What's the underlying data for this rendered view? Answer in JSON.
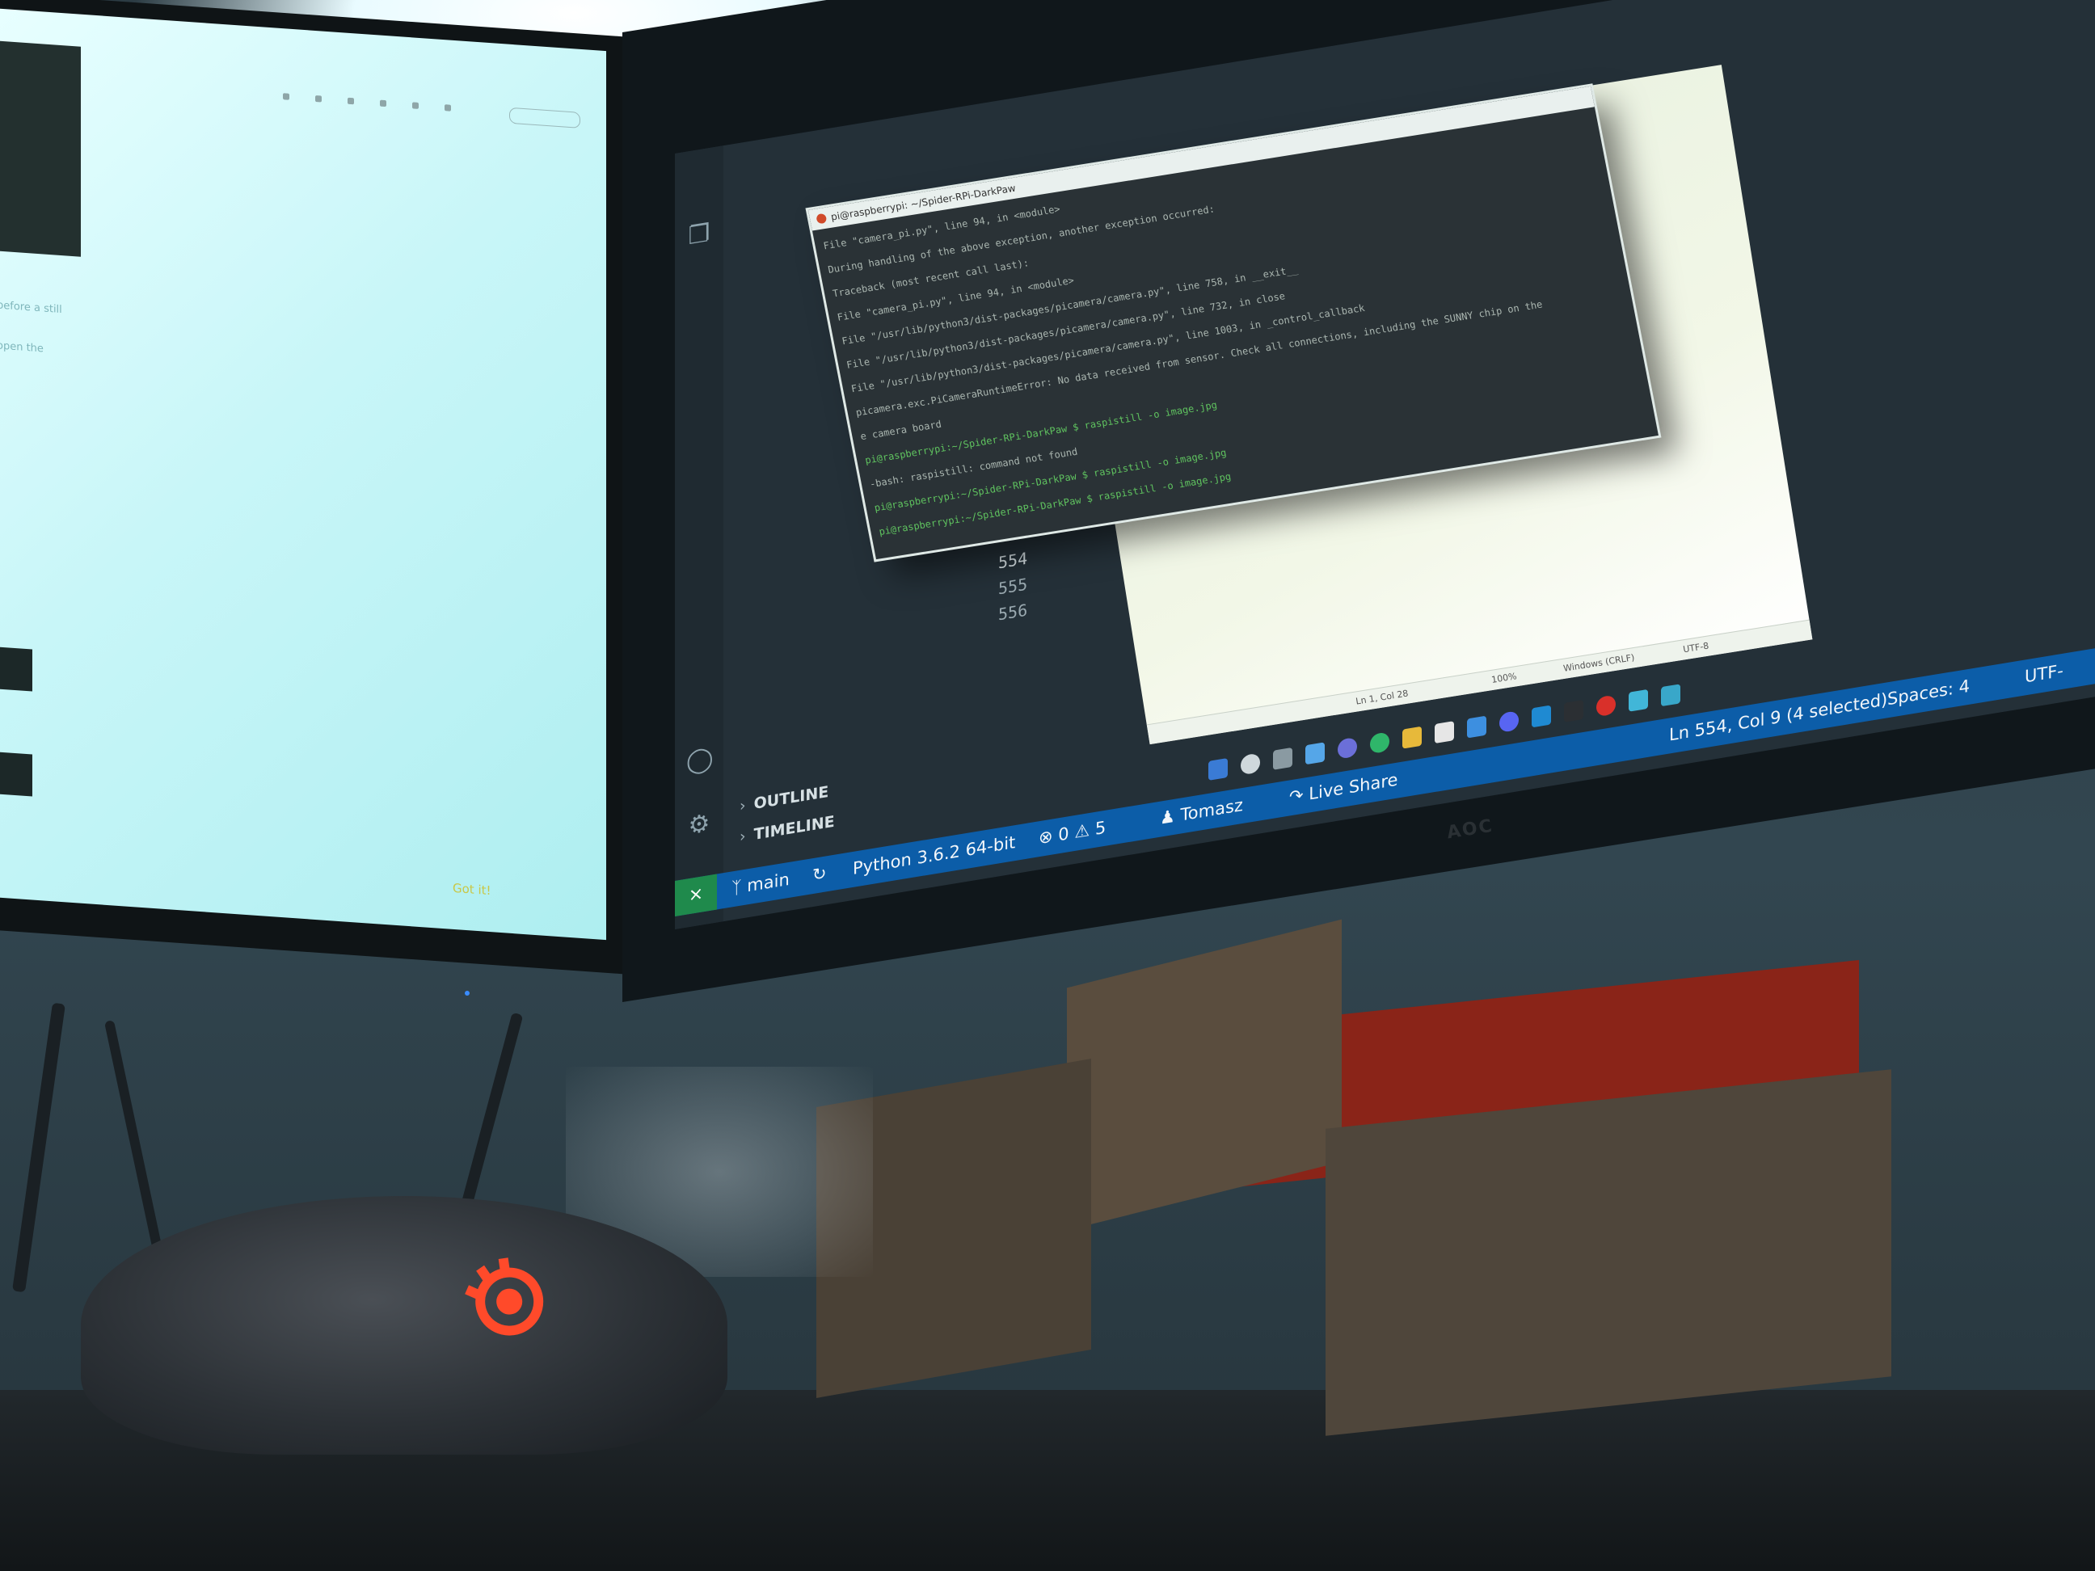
{
  "left_monitor": {
    "snippets": [
      "before a still",
      "open the"
    ],
    "got_it_button": "Got it!"
  },
  "vscode": {
    "side_panels": [
      {
        "label": "OUTLINE"
      },
      {
        "label": "TIMELINE"
      }
    ],
    "line_numbers": [
      "554",
      "555",
      "556"
    ],
    "status_bar": {
      "branch": "main",
      "interpreter": "Python 3.6.2 64-bit",
      "errors": "0",
      "warnings": "5",
      "user": "Tomasz",
      "live_share": "Live Share",
      "cursor": "Ln 554, Col 9 (4 selected)",
      "spaces": "Spaces: 4",
      "encoding": "UTF-"
    }
  },
  "terminal": {
    "title": "pi@raspberrypi: ~/Spider-RPi-DarkPaw",
    "lines": [
      {
        "text": "File \"camera_pi.py\", line 94, in <module>",
        "style": "normal"
      },
      {
        "text": "During handling of the above exception, another exception occurred:",
        "style": "normal"
      },
      {
        "text": "Traceback (most recent call last):",
        "style": "normal"
      },
      {
        "text": "  File \"camera_pi.py\", line 94, in <module>",
        "style": "normal"
      },
      {
        "text": "  File \"/usr/lib/python3/dist-packages/picamera/camera.py\", line 758, in __exit__",
        "style": "normal"
      },
      {
        "text": "  File \"/usr/lib/python3/dist-packages/picamera/camera.py\", line 732, in close",
        "style": "normal"
      },
      {
        "text": "  File \"/usr/lib/python3/dist-packages/picamera/camera.py\", line 1003, in _control_callback",
        "style": "normal"
      },
      {
        "text": "picamera.exc.PiCameraRuntimeError: No data received from sensor. Check all connections, including the SUNNY chip on the",
        "style": "normal"
      },
      {
        "text": "e camera board",
        "style": "normal"
      },
      {
        "text": "pi@raspberrypi:~/Spider-RPi-DarkPaw $ raspistill -o image.jpg",
        "style": "prompt"
      },
      {
        "text": "-bash: raspistill: command not found",
        "style": "normal"
      },
      {
        "text": "pi@raspberrypi:~/Spider-RPi-DarkPaw $ raspistill -o image.jpg",
        "style": "prompt"
      },
      {
        "text": "pi@raspberrypi:~/Spider-RPi-DarkPaw $ raspistill -o image.jpg",
        "style": "prompt"
      }
    ]
  },
  "notepad": {
    "position": "Ln 1, Col 28",
    "zoom": "100%",
    "line_ending": "Windows (CRLF)",
    "encoding": "UTF-8"
  },
  "monitor_brand": "AOC",
  "colors": {
    "statusbar": "#0c5da8",
    "remote": "#1f8a4c",
    "mouse_logo": "#ff4a2a"
  }
}
